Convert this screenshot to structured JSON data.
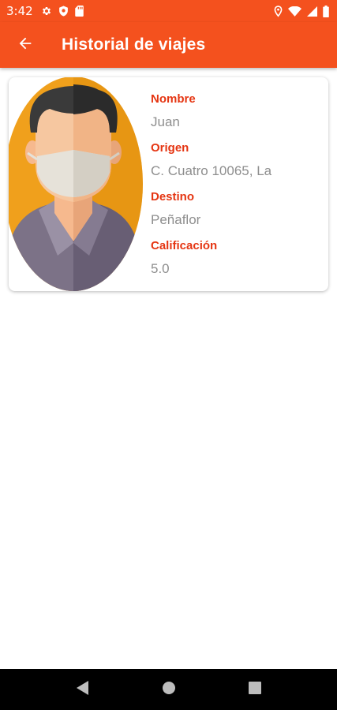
{
  "status_bar": {
    "time": "3:42",
    "left_icons": [
      "gear-icon",
      "shield-icon",
      "sd-card-icon"
    ],
    "right_icons": [
      "location-icon",
      "wifi-icon",
      "signal-icon",
      "battery-icon"
    ]
  },
  "app_bar": {
    "back_icon": "arrow-left-icon",
    "title": "Historial de viajes"
  },
  "trip_card": {
    "avatar_icon": "masked-man-avatar",
    "fields": [
      {
        "label": "Nombre",
        "value": "Juan"
      },
      {
        "label": "Origen",
        "value": "C. Cuatro 10065, La"
      },
      {
        "label": "Destino",
        "value": "Peñaflor"
      },
      {
        "label": "Calificación",
        "value": "5.0"
      }
    ]
  },
  "nav_bar": {
    "buttons": [
      "back-triangle-icon",
      "home-circle-icon",
      "recents-square-icon"
    ]
  },
  "colors": {
    "primary": "#f4511e",
    "label": "#e53512",
    "value": "#8e8e8e",
    "avatar_bg": "#f0a01c"
  }
}
